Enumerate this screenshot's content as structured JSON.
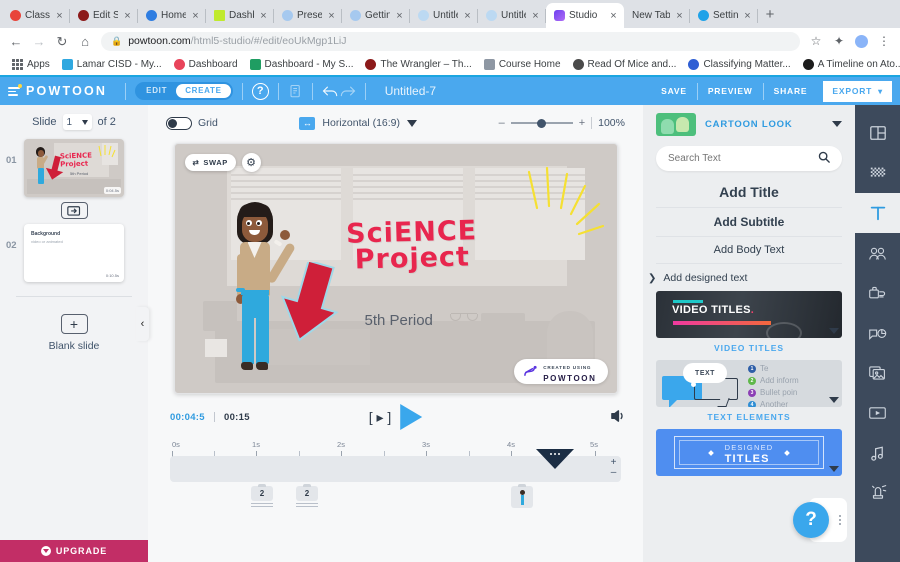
{
  "browser": {
    "tabs": [
      {
        "label": "Class N",
        "favicon": "#e8443a",
        "icon": "gear-icon"
      },
      {
        "label": "Edit Sto",
        "favicon": "#8c1a1a",
        "icon": "circle-icon"
      },
      {
        "label": "Home -",
        "favicon": "#2f7de1",
        "icon": "globe-icon"
      },
      {
        "label": "Dashbo",
        "favicon": "#c0ea2d",
        "icon": "squares-icon"
      },
      {
        "label": "Present",
        "favicon": "#a6c9ef",
        "icon": "circle-icon"
      },
      {
        "label": "Getting",
        "favicon": "#a6c9ef",
        "icon": "circle-icon"
      },
      {
        "label": "Untitled",
        "favicon": "#bcd9f2",
        "icon": "circle-icon"
      },
      {
        "label": "Untitled",
        "favicon": "#bcd9f2",
        "icon": "circle-icon"
      },
      {
        "label": "Studio",
        "favicon": "#7b4df0",
        "icon": "powtoon-icon",
        "active": true
      },
      {
        "label": "New Tab",
        "favicon": "",
        "icon": "none"
      },
      {
        "label": "Settings",
        "favicon": "#1fa2e8",
        "icon": "gear-icon"
      }
    ],
    "new_tab_button": "+",
    "close_label": "×",
    "nav": {
      "back": "←",
      "forward": "→",
      "reload": "↻",
      "home": "⌂"
    },
    "url": {
      "lock": "🔒",
      "domain": "powtoon.com",
      "path": "/html5-studio/#/edit/eoUkMgp1LiJ"
    },
    "omnibox_icons": {
      "star": "☆",
      "extensions": "✦",
      "menu": "⋮"
    },
    "bookmarks": [
      {
        "label": "Apps",
        "icon": "apps-grid-icon",
        "color": "#5f6368"
      },
      {
        "label": "Lamar CISD - My...",
        "icon": "site-icon",
        "color": "#2fa8e0"
      },
      {
        "label": "Dashboard",
        "icon": "site-icon",
        "color": "#e8445a"
      },
      {
        "label": "Dashboard - My S...",
        "icon": "site-icon",
        "color": "#1f9d62"
      },
      {
        "label": "The Wrangler – Th...",
        "icon": "site-icon",
        "color": "#8c1a1a"
      },
      {
        "label": "Course Home",
        "icon": "site-icon",
        "color": "#8e97a3"
      },
      {
        "label": "Read Of Mice and...",
        "icon": "site-icon",
        "color": "#4a4a4a"
      },
      {
        "label": "Classifying Matter...",
        "icon": "site-icon",
        "color": "#2f5fd4"
      },
      {
        "label": "A Timeline on Ato...",
        "icon": "site-icon",
        "color": "#1c1c1c"
      }
    ]
  },
  "powtoon_header": {
    "brand": "POWTOON",
    "mode_edit": "EDIT",
    "mode_create": "CREATE",
    "help_icon": "?",
    "notes_icon": "notes-icon",
    "undo_icon": "undo-icon",
    "redo_icon": "redo-icon",
    "project_title": "Untitled-7",
    "save": "SAVE",
    "preview": "PREVIEW",
    "share": "SHARE",
    "export": "EXPORT",
    "export_caret": "⌄"
  },
  "slides_rail": {
    "slide_word": "Slide",
    "current_slide": "1",
    "of_label": "of 2",
    "slides": [
      {
        "num": "01",
        "badge": "0:04.5s",
        "selected": true
      },
      {
        "num": "02",
        "title": "Background",
        "subtitle": "video or animated",
        "badge": "0:10.5s",
        "selected": false
      }
    ],
    "duplicate_icon": "duplicate-slide-icon",
    "blank_slide_label": "Blank slide",
    "blank_plus": "+",
    "upgrade_label": "UPGRADE",
    "collapse_icon": "‹"
  },
  "stage_bar": {
    "grid_label": "Grid",
    "grid_on": false,
    "ratio_icon": "↔",
    "ratio_label": "Horizontal (16:9)",
    "zoom_minus": "–",
    "zoom_plus": "+",
    "zoom_value": "100%"
  },
  "canvas": {
    "swap_label": "SWAP",
    "swap_icon": "⇄",
    "settings_icon": "⚙",
    "title_line1": "SciENCE",
    "title_line2": "Project",
    "subtitle": "5th Period",
    "watermark_top": "CREATED USING",
    "watermark_bottom": "POWTOON",
    "title_color": "#e8264e",
    "subtitle_color": "#59606c",
    "character": "teacher-character",
    "arrow": "red-down-arrow"
  },
  "playback": {
    "current_time": "00:04:5",
    "total_time": "00:15",
    "prev_frame_icon": "[ ▸ ]",
    "play_icon": "play-triangle",
    "volume_icon": "🔊"
  },
  "timeline": {
    "ticks": [
      "0s",
      "1s",
      "2s",
      "3s",
      "4s",
      "5s"
    ],
    "playhead_position_seconds": 4.5,
    "zoom_in": "+",
    "zoom_out": "–",
    "clips": [
      {
        "label": "2",
        "kind": "text",
        "seconds": 0.95
      },
      {
        "label": "2",
        "kind": "text",
        "seconds": 1.5
      },
      {
        "label": "",
        "kind": "character",
        "seconds": 4.05
      }
    ]
  },
  "right_panel": {
    "look_label": "CARTOON LOOK",
    "look_caret": "▼",
    "search_placeholder": "Search Text",
    "search_value": "",
    "search_icon": "search-icon",
    "options": [
      "Add Title",
      "Add Subtitle",
      "Add Body Text"
    ],
    "add_designed_text": "Add designed text",
    "chevron": "❯",
    "cards": [
      {
        "label": "VIDEO TITLES",
        "preview_text": "VIDEO TITLES",
        "preview_dot": "."
      },
      {
        "label": "TEXT ELEMENTS",
        "bubble_text": "TEXT",
        "list": [
          {
            "num": "1",
            "text": "Te",
            "color": "#2f5fa8"
          },
          {
            "num": "2",
            "text": "Add inform",
            "color": "#5fb84a"
          },
          {
            "num": "3",
            "text": "Bullet poin",
            "color": "#8c3fb5"
          },
          {
            "num": "4",
            "text": "Another",
            "color": "#2f8ed4"
          }
        ]
      },
      {
        "label": "DESIGNED TITLES",
        "line1": "DESIGNED",
        "line2": "TITLES"
      }
    ],
    "help_button": "?",
    "help_menu_icon": "kebab-menu-icon"
  },
  "tool_rail": [
    {
      "name": "layouts-icon",
      "active": false
    },
    {
      "name": "background-icon",
      "active": false
    },
    {
      "name": "text-icon",
      "active": true
    },
    {
      "name": "characters-icon",
      "active": false
    },
    {
      "name": "props-icon",
      "active": false
    },
    {
      "name": "shapes-icon",
      "active": false
    },
    {
      "name": "images-icon",
      "active": false
    },
    {
      "name": "video-icon",
      "active": false
    },
    {
      "name": "music-icon",
      "active": false
    },
    {
      "name": "effects-icon",
      "active": false
    }
  ]
}
